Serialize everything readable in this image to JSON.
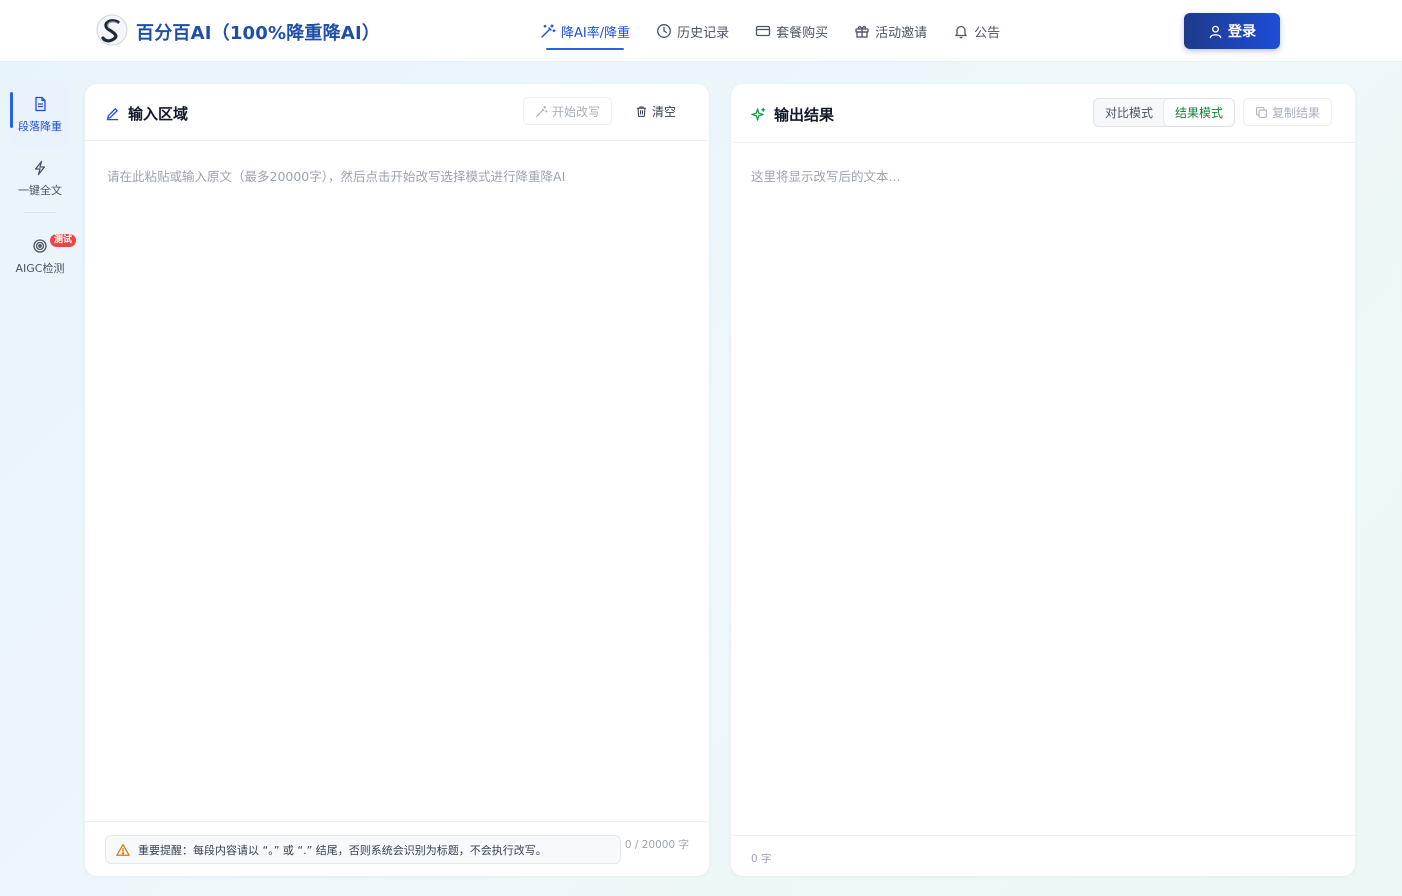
{
  "header": {
    "brand": "百分百AI（100%降重降AI）",
    "nav": [
      {
        "label": "降AI率/降重",
        "icon": "magic-wand-icon",
        "active": true
      },
      {
        "label": "历史记录",
        "icon": "clock-icon",
        "active": false
      },
      {
        "label": "套餐购买",
        "icon": "card-icon",
        "active": false
      },
      {
        "label": "活动邀请",
        "icon": "gift-icon",
        "active": false
      },
      {
        "label": "公告",
        "icon": "bell-icon",
        "active": false
      }
    ],
    "login_label": "登录"
  },
  "sidebar": {
    "items": [
      {
        "label": "段落降重",
        "icon": "document-icon",
        "active": true
      },
      {
        "label": "一键全文",
        "icon": "lightning-icon",
        "active": false
      },
      {
        "label": "AIGC检测",
        "icon": "target-icon",
        "active": false,
        "badge": "测试"
      }
    ]
  },
  "input_panel": {
    "title": "输入区域",
    "start_label": "开始改写",
    "clear_label": "清空",
    "placeholder": "请在此粘贴或输入原文（最多20000字），然后点击开始改写选择模式进行降重降AI",
    "warning": "重要提醒：每段内容请以 “。” 或 “.” 结尾，否则系统会识别为标题，不会执行改写。",
    "counter": "0 / 20000 字"
  },
  "output_panel": {
    "title": "输出结果",
    "modes": [
      {
        "label": "对比模式",
        "active": false
      },
      {
        "label": "结果模式",
        "active": true
      }
    ],
    "copy_label": "复制结果",
    "placeholder": "这里将显示改写后的文本...",
    "word_count": "0 字"
  },
  "colors": {
    "primary": "#1d4ed8",
    "brand_text": "#1e4fa8",
    "success": "#16803c",
    "warning": "#d97706",
    "badge": "#ef4444"
  }
}
